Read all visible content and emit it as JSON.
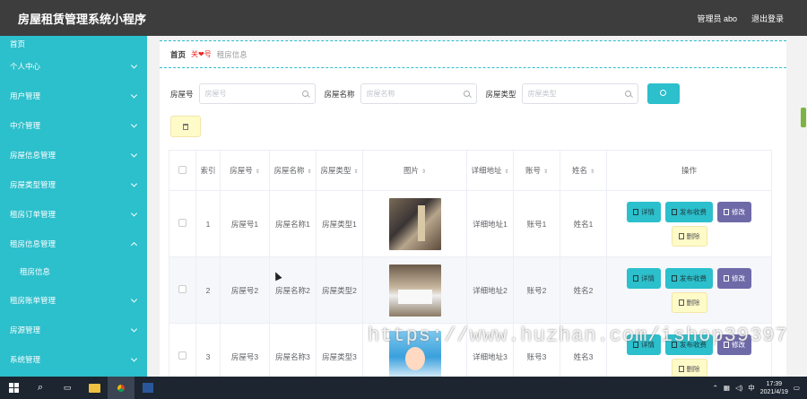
{
  "header": {
    "title": "房屋租赁管理系统小程序",
    "user": "管理员 abo",
    "logout": "退出登录"
  },
  "sidebar": {
    "items": [
      {
        "label": "首页"
      },
      {
        "label": "个人中心"
      },
      {
        "label": "用户管理"
      },
      {
        "label": "中介管理"
      },
      {
        "label": "房屋信息管理"
      },
      {
        "label": "房屋类型管理"
      },
      {
        "label": "租房订单管理"
      },
      {
        "label": "租房信息管理"
      },
      {
        "label": "租房信息"
      },
      {
        "label": "租房账单管理"
      },
      {
        "label": "房源管理"
      },
      {
        "label": "系统管理"
      }
    ]
  },
  "breadcrumb": {
    "home": "首页",
    "sep": "关❤号",
    "current": "租房信息"
  },
  "search": {
    "field1_label": "房屋号",
    "field1_placeholder": "房屋号",
    "field2_label": "房屋名称",
    "field2_placeholder": "房屋名称",
    "field3_label": "房屋类型",
    "field3_placeholder": "房屋类型"
  },
  "table": {
    "headers": {
      "index": "索引",
      "house_no": "房屋号",
      "house_name": "房屋名称",
      "house_type": "房屋类型",
      "image": "图片",
      "address": "详细地址",
      "account": "账号",
      "name": "姓名",
      "ops": "操作"
    },
    "rows": [
      {
        "index": "1",
        "house_no": "房屋号1",
        "house_name": "房屋名称1",
        "house_type": "房屋类型1",
        "address": "详细地址1",
        "account": "账号1",
        "name": "姓名1"
      },
      {
        "index": "2",
        "house_no": "房屋号2",
        "house_name": "房屋名称2",
        "house_type": "房屋类型2",
        "address": "详细地址2",
        "account": "账号2",
        "name": "姓名2"
      },
      {
        "index": "3",
        "house_no": "房屋号3",
        "house_name": "房屋名称3",
        "house_type": "房屋类型3",
        "address": "详细地址3",
        "account": "账号3",
        "name": "姓名3"
      }
    ],
    "buttons": {
      "detail": "详情",
      "publish": "发布收费",
      "edit": "修改",
      "delete": "删除"
    }
  },
  "taskbar": {
    "ime": "中",
    "time": "17:39",
    "date": "2021/4/19"
  },
  "watermark": "https://www.huzhan.com/ishop39397"
}
